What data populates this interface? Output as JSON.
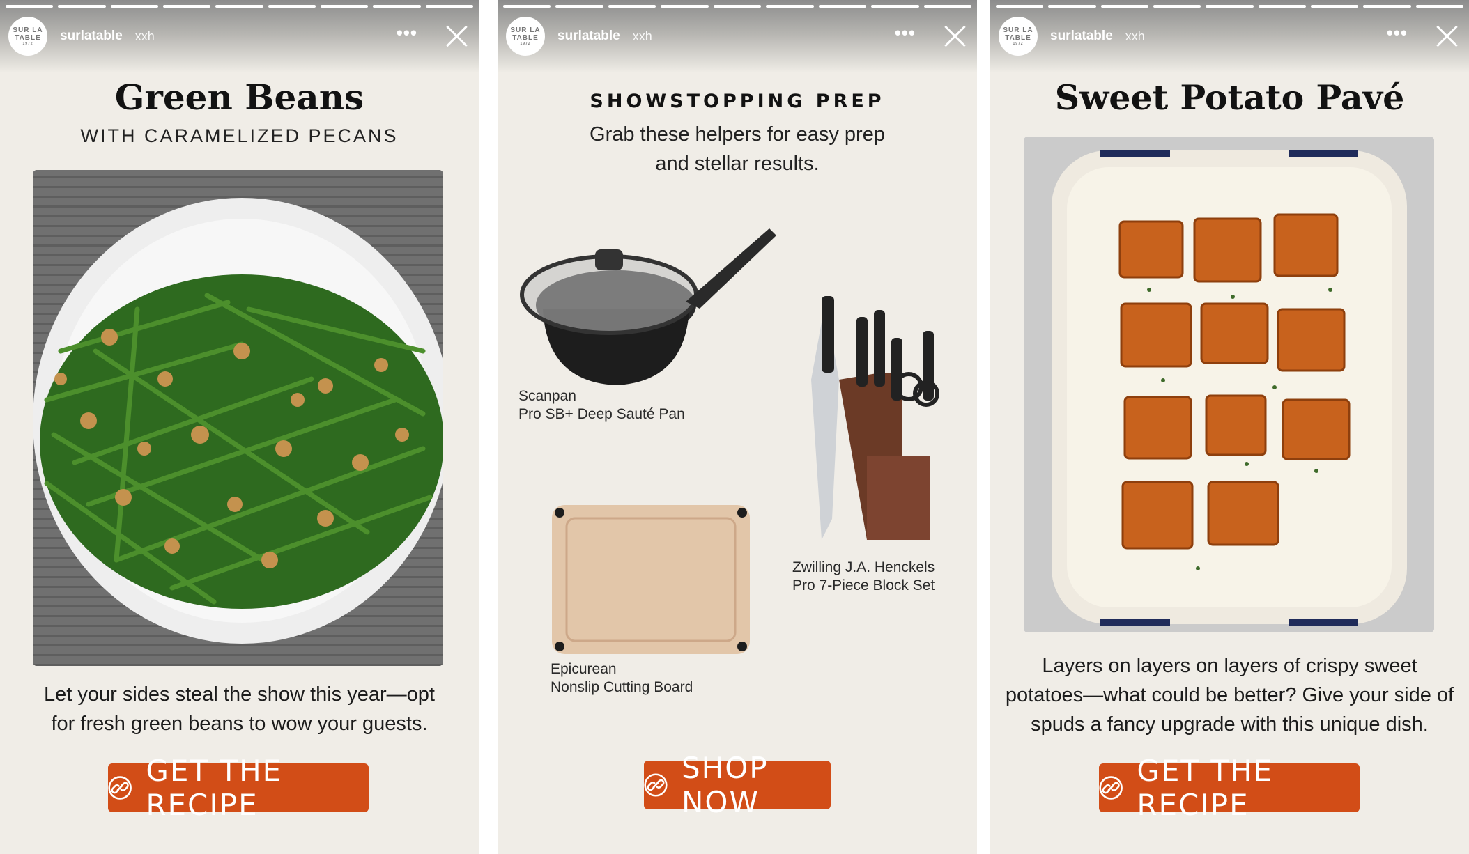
{
  "stories": [
    {
      "account": {
        "avatar_text": [
          "SUR LA",
          "TABLE",
          "1972"
        ],
        "username": "surlatable",
        "time": "xxh"
      },
      "title": "Green Beans",
      "subtitle": "WITH CARAMELIZED PECANS",
      "body": "Let your sides steal the show this year—opt for fresh green beans to wow your guests.",
      "cta": "GET THE RECIPE",
      "cta_icon": "link-icon"
    },
    {
      "account": {
        "avatar_text": [
          "SUR LA",
          "TABLE",
          "1972"
        ],
        "username": "surlatable",
        "time": "xxh"
      },
      "title": "SHOWSTOPPING PREP",
      "subtitle": "Grab these helpers for easy prep and stellar results.",
      "products": [
        {
          "brand": "Scanpan",
          "name": "Pro SB+ Deep Sauté Pan"
        },
        {
          "brand": "Zwilling J.A. Henckels",
          "name": "Pro 7-Piece Block Set"
        },
        {
          "brand": "Epicurean",
          "name": "Nonslip Cutting Board"
        }
      ],
      "cta": "SHOP NOW",
      "cta_icon": "link-icon"
    },
    {
      "account": {
        "avatar_text": [
          "SUR LA",
          "TABLE",
          "1972"
        ],
        "username": "surlatable",
        "time": "xxh"
      },
      "title": "Sweet Potato Pavé",
      "body": "Layers on layers on layers of crispy sweet potatoes—what could be better? Give your side of spuds a fancy upgrade with this unique dish.",
      "cta": "GET THE RECIPE",
      "cta_icon": "link-icon"
    }
  ],
  "colors": {
    "cta": "#d24d17",
    "background": "#f0ede7"
  }
}
